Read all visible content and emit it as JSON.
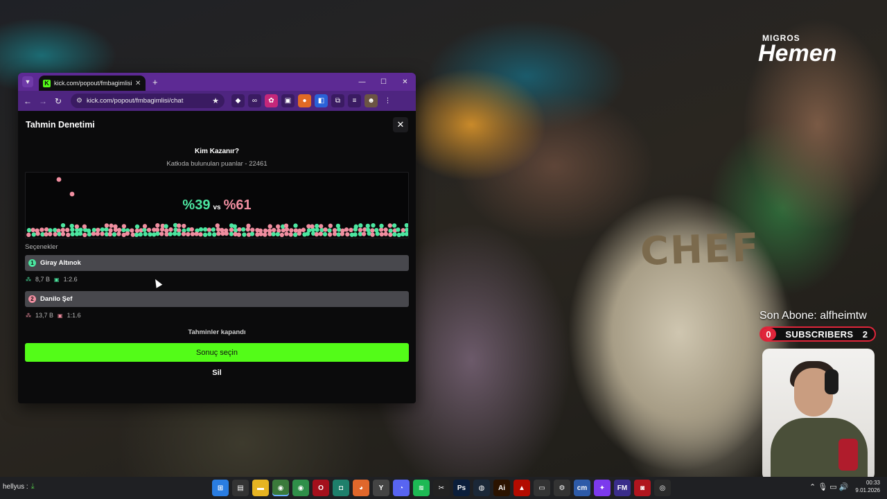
{
  "stream": {
    "brand_small": "MIGROS",
    "brand_big": "Hemen",
    "jersey_text": "CHEF",
    "last_sub_label": "Son Abone: alfheimtw",
    "sub_left_count": "0",
    "sub_label": "SUBSCRIBERS",
    "sub_right_count": "2"
  },
  "browser": {
    "tab_title": "kick.com/popout/fmbagimlisi/c",
    "tab_close": "✕",
    "new_tab": "+",
    "url": "kick.com/popout/fmbagimlisi/chat",
    "window_controls": {
      "minimize": "—",
      "maximize": "☐",
      "close": "✕"
    },
    "nav": {
      "back": "←",
      "forward": "→",
      "reload": "↻"
    },
    "extensions": [
      {
        "icon": "diamond-ext-icon",
        "glyph": "◆",
        "color": "#3a1b62"
      },
      {
        "icon": "glasses-ext-icon",
        "glyph": "∞",
        "color": "#3a1b62"
      },
      {
        "icon": "pink-ext-icon",
        "glyph": "✿",
        "color": "#c4277a"
      },
      {
        "icon": "screen-ext-icon",
        "glyph": "▣",
        "color": "#3a1b62"
      },
      {
        "icon": "orange-ext-icon",
        "glyph": "●",
        "color": "#e06a24"
      },
      {
        "icon": "blue-ext-icon",
        "glyph": "◧",
        "color": "#2a62d8"
      },
      {
        "icon": "puzzle-ext-icon",
        "glyph": "⧉",
        "color": "#3a1b62"
      },
      {
        "icon": "playlist-ext-icon",
        "glyph": "≡",
        "color": "#3a1b62"
      },
      {
        "icon": "profile-avatar-icon",
        "glyph": "☻",
        "color": "#6b5444"
      },
      {
        "icon": "menu-kebab-icon",
        "glyph": "⋮",
        "color": "#4e2580"
      }
    ]
  },
  "prediction": {
    "title": "Tahmin Denetimi",
    "close": "✕",
    "question": "Kim Kazanır?",
    "points": "Katkıda bulunulan puanlar - 22461",
    "percent_a": "%39",
    "vs": "vs",
    "percent_b": "%61",
    "share_a": 0.39,
    "colors": {
      "a": "#4ce6a0",
      "b": "#f08ea0",
      "accent": "#53fc18"
    },
    "options_label": "Seçenekler",
    "options": [
      {
        "num": "1",
        "name": "Giray Altınok",
        "points": "8,7 B",
        "ratio": "1:2.6"
      },
      {
        "num": "2",
        "name": "Danilo Şef",
        "points": "13,7 B",
        "ratio": "1:1.6"
      }
    ],
    "closed_text": "Tahminler kapandı",
    "result_button": "Sonuç seçin",
    "delete_button": "Sil"
  },
  "taskbar": {
    "user": "hellyus :",
    "apps": [
      {
        "icon": "windows-start-icon",
        "glyph": "⊞",
        "color": "#2a7de1"
      },
      {
        "icon": "notes-app-icon",
        "glyph": "▤",
        "color": "#333"
      },
      {
        "icon": "file-explorer-icon",
        "glyph": "▬",
        "color": "#e6b422"
      },
      {
        "icon": "chrome-active-icon",
        "glyph": "◉",
        "color": "#3b7a3b",
        "active": true
      },
      {
        "icon": "chrome-icon",
        "glyph": "◉",
        "color": "#2f8f49"
      },
      {
        "icon": "opera-icon",
        "glyph": "O",
        "color": "#a4101c"
      },
      {
        "icon": "app-green-icon",
        "glyph": "◘",
        "color": "#1e7f6b"
      },
      {
        "icon": "firefox-icon",
        "glyph": "◕",
        "color": "#e0672b"
      },
      {
        "icon": "yandex-icon",
        "glyph": "Y",
        "color": "#444"
      },
      {
        "icon": "discord-icon",
        "glyph": "◔",
        "color": "#5865f2"
      },
      {
        "icon": "spotify-icon",
        "glyph": "≋",
        "color": "#1db954"
      },
      {
        "icon": "capcut-icon",
        "glyph": "✂",
        "color": "#222"
      },
      {
        "icon": "photoshop-icon",
        "glyph": "Ps",
        "color": "#0b1e3b"
      },
      {
        "icon": "steam-icon",
        "glyph": "◍",
        "color": "#1b2838"
      },
      {
        "icon": "illustrator-icon",
        "glyph": "Ai",
        "color": "#2b1300"
      },
      {
        "icon": "acrobat-icon",
        "glyph": "▲",
        "color": "#b30b00"
      },
      {
        "icon": "video-app-icon",
        "glyph": "▭",
        "color": "#333"
      },
      {
        "icon": "settings-icon",
        "glyph": "⚙",
        "color": "#333"
      },
      {
        "icon": "cm-app-icon",
        "glyph": "cm",
        "color": "#2d5aa8"
      },
      {
        "icon": "purple-app-icon",
        "glyph": "✦",
        "color": "#7c3aed"
      },
      {
        "icon": "fm-app-icon",
        "glyph": "FM",
        "color": "#3a2d8a"
      },
      {
        "icon": "record-app-icon",
        "glyph": "◙",
        "color": "#b0151e"
      },
      {
        "icon": "obs-icon",
        "glyph": "◎",
        "color": "#2a2a2a"
      }
    ],
    "tray_icons": "⌃  🎙  ▭  🔊",
    "time": "00:33",
    "date": "9.01.2026"
  }
}
